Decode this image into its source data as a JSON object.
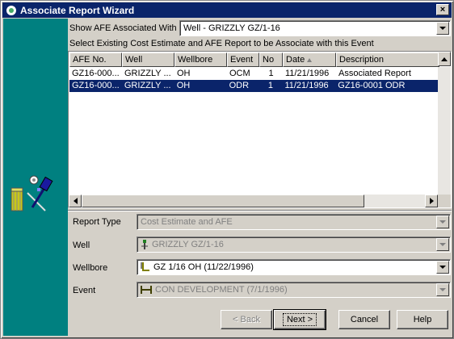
{
  "window": {
    "title": "Associate Report Wizard",
    "close_label": "×"
  },
  "filter": {
    "label": "Show AFE Associated With",
    "value": "Well - GRIZZLY GZ/1-16"
  },
  "instruction": "Select Existing Cost Estimate and AFE Report to be Associate with this Event",
  "grid": {
    "columns": [
      "AFE No.",
      "Well",
      "Wellbore",
      "Event",
      "No",
      "Date",
      "Description"
    ],
    "rows": [
      {
        "afe": "GZ16-000...",
        "well": "GRIZZLY ...",
        "wellbore": "OH",
        "event": "OCM",
        "no": "1",
        "date": "11/21/1996",
        "description": "Associated Report",
        "selected": false
      },
      {
        "afe": "GZ16-000...",
        "well": "GRIZZLY ...",
        "wellbore": "OH",
        "event": "ODR",
        "no": "1",
        "date": "11/21/1996",
        "description": "GZ16-0001 ODR",
        "selected": true
      }
    ]
  },
  "fields": {
    "report_type": {
      "label": "Report Type",
      "value": "Cost Estimate and AFE",
      "icon": "",
      "disabled": true
    },
    "well": {
      "label": "Well",
      "value": "GRIZZLY GZ/1-16",
      "icon": "well-icon",
      "disabled": true
    },
    "wellbore": {
      "label": "Wellbore",
      "value": "GZ 1/16 OH (11/22/1996)",
      "icon": "wellbore-icon",
      "disabled": false
    },
    "event": {
      "label": "Event",
      "value": "CON DEVELOPMENT (7/1/1996)",
      "icon": "event-icon",
      "disabled": true
    }
  },
  "buttons": {
    "back": "< Back",
    "next": "Next >",
    "cancel": "Cancel",
    "help": "Help"
  },
  "colors": {
    "title_bar": "#0a246a",
    "side_panel": "#008080",
    "selection": "#0a246a",
    "face": "#d4d0c8"
  }
}
